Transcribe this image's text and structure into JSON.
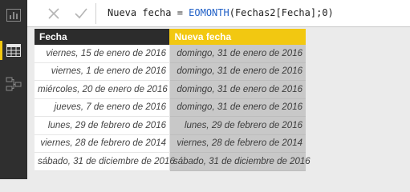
{
  "sidebar": {
    "items": [
      {
        "icon": "report-icon",
        "active": false
      },
      {
        "icon": "data-grid-icon",
        "active": true
      },
      {
        "icon": "relationships-icon",
        "active": false
      }
    ]
  },
  "formula_bar": {
    "cancel_icon": "close-icon",
    "confirm_icon": "checkmark-icon",
    "formula_prefix": "Nueva fecha = ",
    "formula_function": "EOMONTH",
    "formula_args": "(Fechas2[Fecha];0)"
  },
  "table": {
    "columns": [
      "Fecha",
      "Nueva fecha"
    ],
    "rows": [
      [
        "viernes, 15 de enero de 2016",
        "domingo, 31 de enero de 2016"
      ],
      [
        "viernes, 1 de enero de 2016",
        "domingo, 31 de enero de 2016"
      ],
      [
        "miércoles, 20 de enero de 2016",
        "domingo, 31 de enero de 2016"
      ],
      [
        "jueves, 7 de enero de 2016",
        "domingo, 31 de enero de 2016"
      ],
      [
        "lunes, 29 de febrero de 2016",
        "lunes, 29 de febrero de 2016"
      ],
      [
        "viernes, 28 de febrero de 2014",
        "viernes, 28 de febrero de 2014"
      ],
      [
        "sábado, 31 de diciembre de 2016",
        "sábado, 31 de diciembre de 2016"
      ]
    ]
  },
  "colors": {
    "accent": "#f2c811",
    "sidebar_bg": "#2f2f2f",
    "selected_column_bg": "#c8c8c8"
  }
}
